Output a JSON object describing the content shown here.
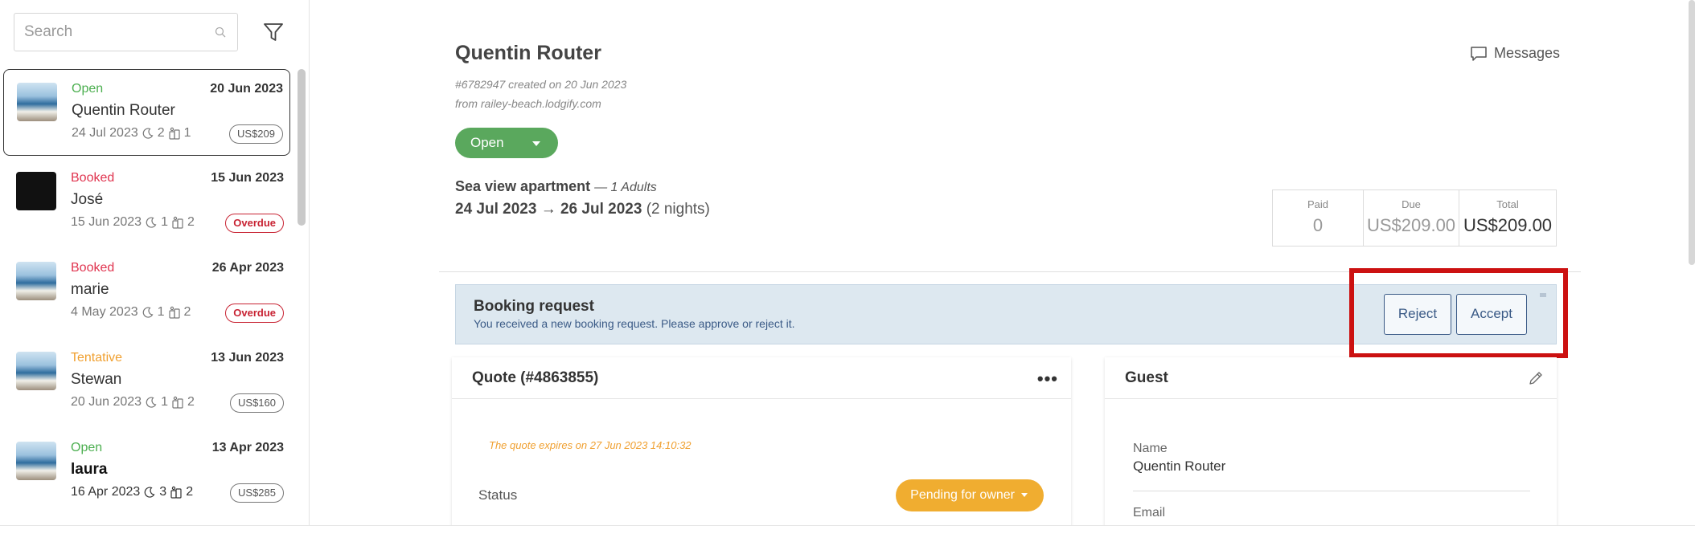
{
  "sidebar": {
    "search_placeholder": "Search",
    "conversations": [
      {
        "status": "Open",
        "status_class": "open",
        "date": "20 Jun 2023",
        "name": "Quentin Router",
        "meta_date": "24 Jul 2023",
        "nights": "2",
        "guests": "1",
        "badge": "US$209",
        "thumb": "sea",
        "active": true
      },
      {
        "status": "Booked",
        "status_class": "booked",
        "date": "15 Jun 2023",
        "name": "José",
        "meta_date": "15 Jun 2023",
        "nights": "1",
        "guests": "2",
        "badge": "Overdue",
        "thumb": "dark"
      },
      {
        "status": "Booked",
        "status_class": "booked",
        "date": "26 Apr 2023",
        "name": "marie",
        "meta_date": "4 May 2023",
        "nights": "1",
        "guests": "2",
        "badge": "Overdue",
        "thumb": "sea"
      },
      {
        "status": "Tentative",
        "status_class": "tentative",
        "date": "13 Jun 2023",
        "name": "Stewan",
        "meta_date": "20 Jun 2023",
        "nights": "1",
        "guests": "2",
        "badge": "US$160",
        "thumb": "sea"
      },
      {
        "status": "Open",
        "status_class": "open",
        "date": "13 Apr 2023",
        "name": "laura",
        "meta_date": "16 Apr 2023",
        "nights": "3",
        "guests": "2",
        "badge": "US$285",
        "thumb": "sea",
        "unread": true
      }
    ]
  },
  "booking": {
    "guest_name": "Quentin Router",
    "created_line": "#6782947 created on 20 Jun 2023",
    "source_line": "from railey-beach.lodgify.com",
    "status_label": "Open",
    "messages_label": "Messages",
    "property": "Sea view apartment",
    "guests_text": "— 1 Adults",
    "check_in": "24 Jul 2023",
    "check_out": "26 Jul 2023",
    "nights_text": "(2 nights)",
    "payment": {
      "paid_label": "Paid",
      "paid_value": "0",
      "due_label": "Due",
      "due_value": "US$209.00",
      "total_label": "Total",
      "total_value": "US$209.00"
    }
  },
  "request": {
    "title": "Booking request",
    "text": "You received a new booking request. Please approve or reject it.",
    "reject_label": "Reject",
    "accept_label": "Accept"
  },
  "quote": {
    "title": "Quote (#4863855)",
    "more": "•••",
    "expires": "The quote expires on 27 Jun 2023 14:10:32",
    "status_label": "Status",
    "status_value": "Pending for owner"
  },
  "guest": {
    "title": "Guest",
    "name_label": "Name",
    "name_value": "Quentin Router",
    "email_label": "Email"
  },
  "colors": {
    "open": "#4caf50",
    "booked": "#e0344f",
    "tentative": "#f0a030",
    "accent_blue": "#3a5a86",
    "highlight": "#cc1111",
    "pending": "#f0ad30",
    "status_green": "#5aa85d"
  }
}
